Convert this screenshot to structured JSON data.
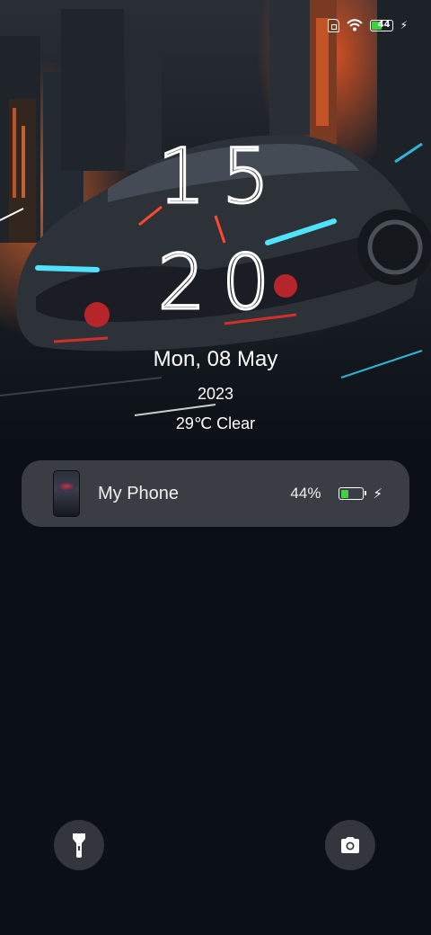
{
  "status_bar": {
    "battery_level": "44",
    "icons": [
      "sim-icon",
      "wifi-icon",
      "battery-icon",
      "charging-bolt-icon"
    ]
  },
  "lock_screen": {
    "clock_hours": "15",
    "clock_minutes": "20",
    "date": "Mon, 08 May",
    "year": "2023",
    "weather": "29℃ Clear"
  },
  "device_card": {
    "name": "My Phone",
    "battery_percent": "44%",
    "battery_fraction": 0.44,
    "charging": true
  },
  "shortcuts": {
    "left_icon": "flashlight-icon",
    "right_icon": "camera-icon"
  },
  "colors": {
    "battery_green": "#3ed33e",
    "card_background": "#3a3e44",
    "screen_background": "#0b1016"
  }
}
